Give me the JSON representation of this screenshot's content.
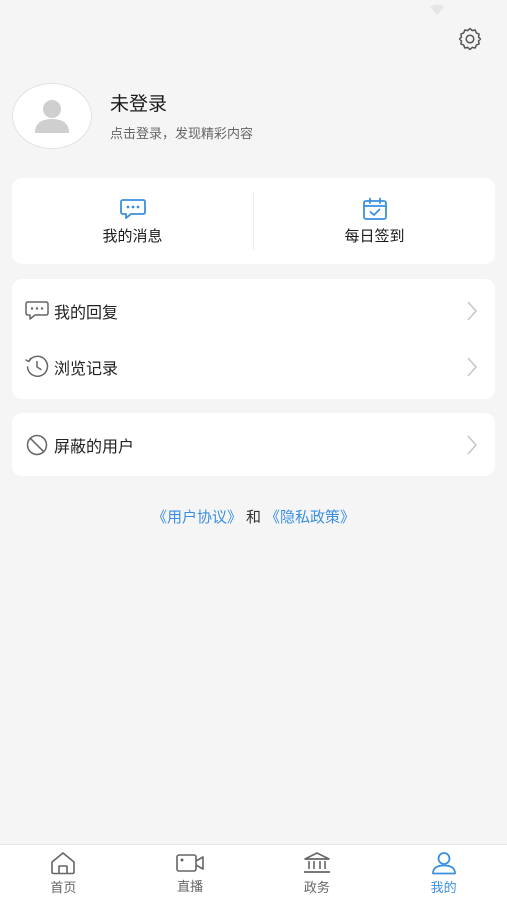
{
  "profile": {
    "name": "未登录",
    "subtitle": "点击登录，发现精彩内容"
  },
  "quick_actions": [
    {
      "label": "我的消息",
      "icon": "chat-bubble-icon"
    },
    {
      "label": "每日签到",
      "icon": "calendar-check-icon"
    }
  ],
  "menu_group1": [
    {
      "label": "我的回复",
      "icon": "reply-icon"
    },
    {
      "label": "浏览记录",
      "icon": "history-icon"
    }
  ],
  "menu_group2": [
    {
      "label": "屏蔽的用户",
      "icon": "block-icon"
    }
  ],
  "agreement": {
    "user_agreement": "《用户协议》",
    "and": "和",
    "privacy_policy": "《隐私政策》"
  },
  "tabbar": [
    {
      "label": "首页",
      "icon": "home-icon",
      "active": false
    },
    {
      "label": "直播",
      "icon": "video-camera-icon",
      "active": false
    },
    {
      "label": "政务",
      "icon": "government-building-icon",
      "active": false
    },
    {
      "label": "我的",
      "icon": "user-icon",
      "active": true
    }
  ],
  "colors": {
    "accent": "#3b8fe0",
    "background": "#f5f5f5",
    "card": "#ffffff"
  }
}
